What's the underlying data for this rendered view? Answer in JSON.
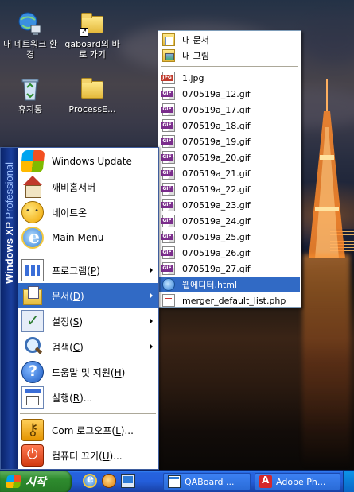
{
  "desktop": {
    "icons": [
      {
        "label": "내 네트워크 환경",
        "icon": "network-places-icon"
      },
      {
        "label": "qaboard의 바로 가기",
        "icon": "folder-shortcut-icon"
      },
      {
        "label": "휴지통",
        "icon": "recycle-bin-icon"
      },
      {
        "label": "ProcessE...",
        "icon": "folder-icon"
      }
    ]
  },
  "start_menu": {
    "banner_bold": "Windows XP",
    "banner_thin": "Professional",
    "pinned": [
      {
        "label": "Windows Update",
        "icon": "windows-update-icon"
      },
      {
        "label": "깨비홈서버",
        "icon": "home-server-icon"
      },
      {
        "label": "네이트온",
        "icon": "nateon-icon"
      },
      {
        "label": "Main Menu",
        "icon": "internet-explorer-icon"
      }
    ],
    "items": [
      {
        "label": "프로그램(",
        "key": "P",
        "suffix": ")",
        "icon": "programs-icon",
        "submenu": true
      },
      {
        "label": "문서(",
        "key": "D",
        "suffix": ")",
        "icon": "documents-icon",
        "submenu": true,
        "selected": true
      },
      {
        "label": "설정(",
        "key": "S",
        "suffix": ")",
        "icon": "settings-icon",
        "submenu": true
      },
      {
        "label": "검색(",
        "key": "C",
        "suffix": ")",
        "icon": "search-icon",
        "submenu": true
      },
      {
        "label": "도움말 및 지원(",
        "key": "H",
        "suffix": ")",
        "icon": "help-icon",
        "submenu": false
      },
      {
        "label": "실행(",
        "key": "R",
        "suffix": ")...",
        "icon": "run-icon",
        "submenu": false
      }
    ],
    "bottom": [
      {
        "label": "Com 로그오프(",
        "key": "L",
        "suffix": ")...",
        "icon": "logoff-icon"
      },
      {
        "label": "컴퓨터 끄기(",
        "key": "U",
        "suffix": ")...",
        "icon": "power-icon"
      }
    ]
  },
  "documents_submenu": {
    "folders": [
      {
        "label": "내 문서",
        "icon": "my-documents-icon"
      },
      {
        "label": "내 그림",
        "icon": "my-pictures-icon"
      }
    ],
    "files": [
      {
        "label": "1.jpg",
        "icon": "jpg-file-icon"
      },
      {
        "label": "070519a_12.gif",
        "icon": "gif-file-icon"
      },
      {
        "label": "070519a_17.gif",
        "icon": "gif-file-icon"
      },
      {
        "label": "070519a_18.gif",
        "icon": "gif-file-icon"
      },
      {
        "label": "070519a_19.gif",
        "icon": "gif-file-icon"
      },
      {
        "label": "070519a_20.gif",
        "icon": "gif-file-icon"
      },
      {
        "label": "070519a_21.gif",
        "icon": "gif-file-icon"
      },
      {
        "label": "070519a_22.gif",
        "icon": "gif-file-icon"
      },
      {
        "label": "070519a_23.gif",
        "icon": "gif-file-icon"
      },
      {
        "label": "070519a_24.gif",
        "icon": "gif-file-icon"
      },
      {
        "label": "070519a_25.gif",
        "icon": "gif-file-icon"
      },
      {
        "label": "070519a_26.gif",
        "icon": "gif-file-icon"
      },
      {
        "label": "070519a_27.gif",
        "icon": "gif-file-icon"
      },
      {
        "label": "웹에디터.html",
        "icon": "html-file-icon",
        "selected": true
      },
      {
        "label": "merger_default_list.php",
        "icon": "php-file-icon"
      }
    ]
  },
  "taskbar": {
    "start_label": "시작",
    "quick_launch": [
      "internet-explorer-icon",
      "media-player-icon",
      "show-desktop-icon"
    ],
    "tasks": [
      {
        "label": "QABoard ...",
        "icon": "qaboard-window-icon"
      },
      {
        "label": "Adobe Ph...",
        "icon": "adobe-photoshop-icon"
      }
    ]
  },
  "colors": {
    "selection": "#316ac5",
    "taskbar": "#245edb",
    "start_button": "#2e8b2e",
    "banner": "#0a246a"
  }
}
